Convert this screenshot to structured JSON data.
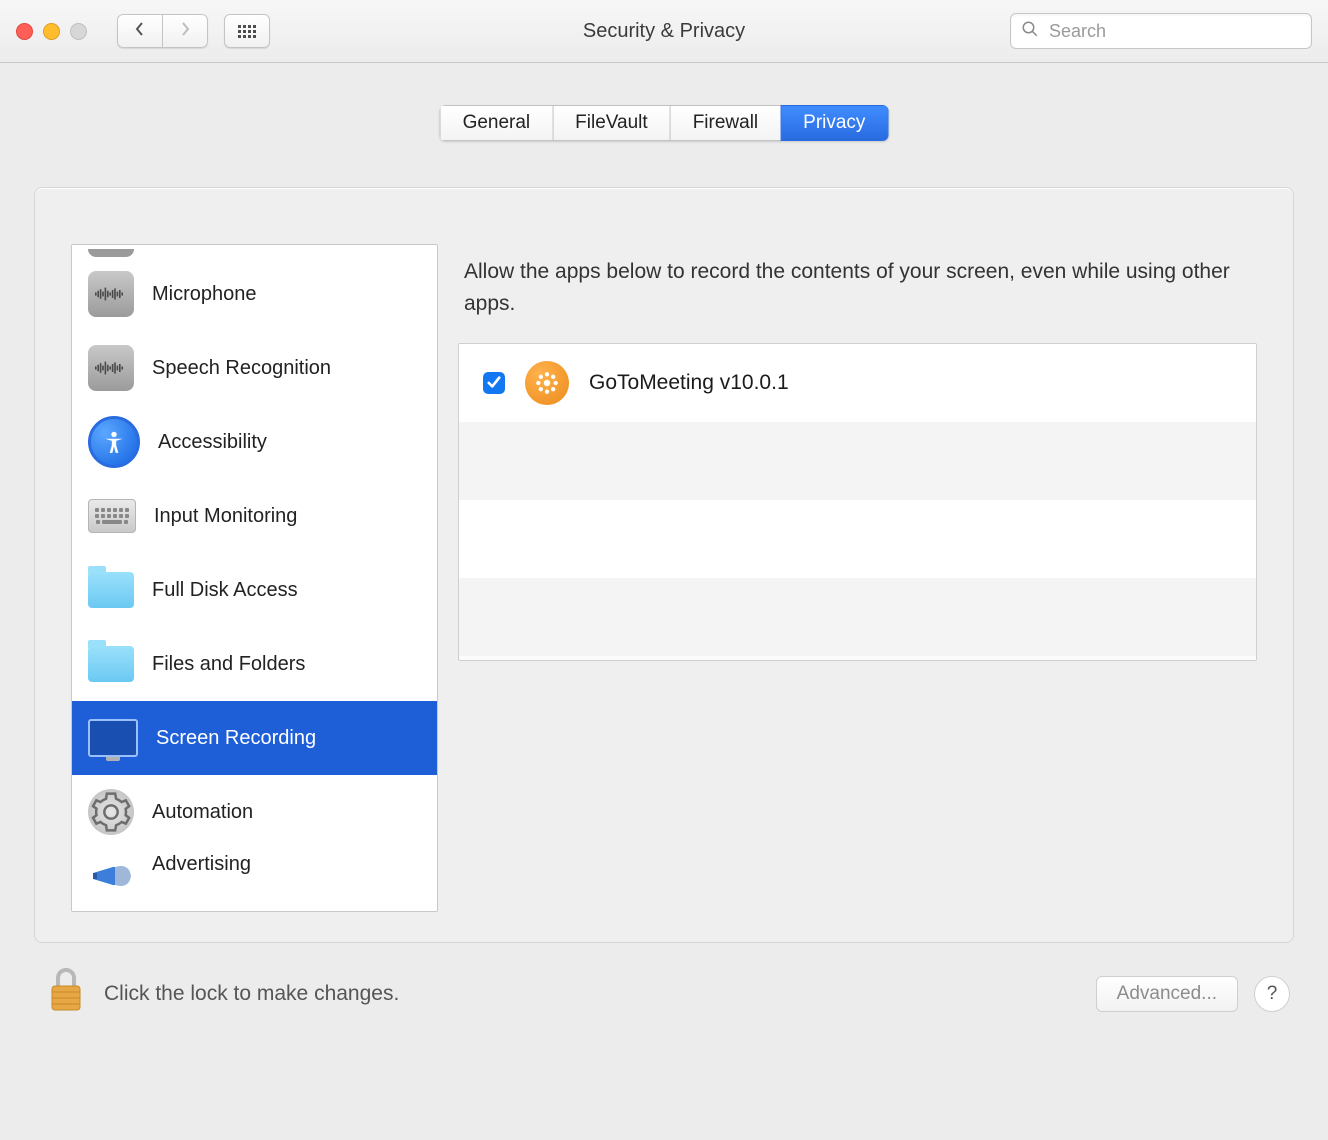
{
  "window": {
    "title": "Security & Privacy"
  },
  "toolbar": {
    "search_placeholder": "Search"
  },
  "tabs": {
    "general": "General",
    "filevault": "FileVault",
    "firewall": "Firewall",
    "privacy": "Privacy"
  },
  "sidebar": {
    "microphone": "Microphone",
    "speech": "Speech Recognition",
    "accessibility": "Accessibility",
    "input_monitoring": "Input Monitoring",
    "full_disk": "Full Disk Access",
    "files": "Files and Folders",
    "screen_recording": "Screen Recording",
    "automation": "Automation",
    "advertising": "Advertising"
  },
  "content": {
    "description": "Allow the apps below to record the contents of your screen, even while using other apps.",
    "apps": [
      {
        "name": "GoToMeeting v10.0.1",
        "checked": true
      }
    ]
  },
  "footer": {
    "lock_text": "Click the lock to make changes.",
    "advanced": "Advanced...",
    "help": "?"
  },
  "colors": {
    "selection_blue": "#1e5fd8",
    "tab_active": "#2a6be0",
    "checkbox": "#1178f2"
  }
}
